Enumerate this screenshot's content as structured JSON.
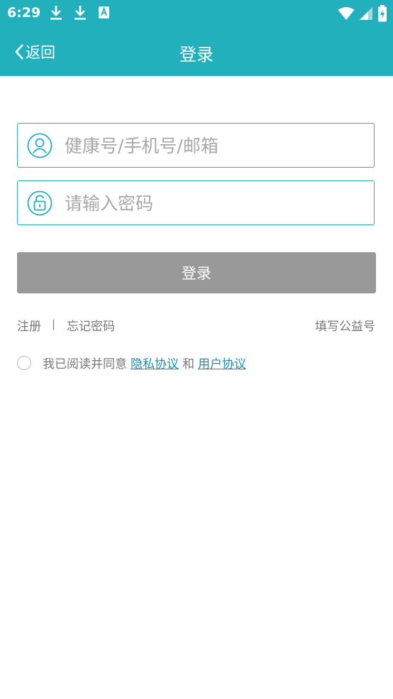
{
  "status_bar": {
    "time": "6:29"
  },
  "app_bar": {
    "back_label": "返回",
    "title": "登录"
  },
  "form": {
    "account": {
      "value": "",
      "placeholder": "健康号/手机号/邮箱"
    },
    "password": {
      "value": "",
      "placeholder": "请输入密码"
    },
    "login_button": "登录"
  },
  "links": {
    "register": "注册",
    "divider": "|",
    "forgot_password": "忘记密码",
    "fill_welfare_code": "填写公益号"
  },
  "agreement": {
    "prefix": "我已阅读并同意",
    "privacy_link": "隐私协议",
    "conjunction": "和",
    "user_link": "用户协议",
    "checked": false
  },
  "colors": {
    "accent": "#22b0bd",
    "button_disabled": "#999999",
    "link": "#1a8fb0"
  },
  "icons": [
    "download-icon",
    "download-icon",
    "keyboard-a-icon",
    "wifi-icon",
    "signal-icon",
    "battery-icon",
    "chevron-left-icon",
    "user-icon",
    "lock-icon"
  ]
}
